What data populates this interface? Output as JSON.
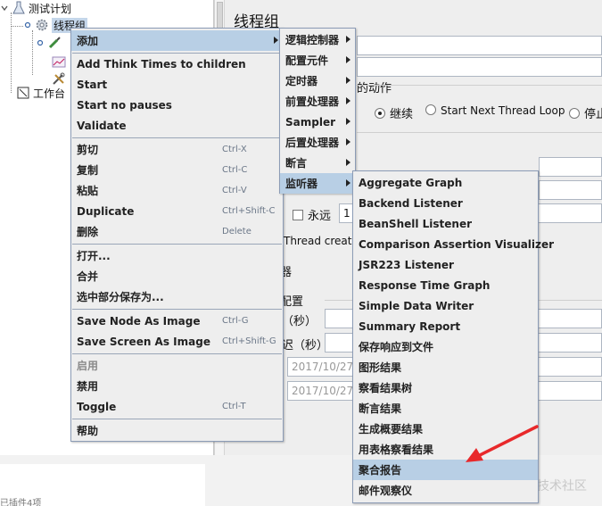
{
  "tree": {
    "test_plan": "测试计划",
    "thread_group": "线程组",
    "workbench": "工作台"
  },
  "panel": {
    "title": "线程组",
    "action_label": "的动作",
    "opt_continue": "继续",
    "opt_next_loop": "Start Next Thread Loop",
    "opt_stop": "停止",
    "forever_label": "永远",
    "loop_value": "1",
    "thread_creation": "Thread creat",
    "scheduler_fragment": "器",
    "config_fragment": "配置",
    "duration_fragment": "（秒）",
    "delay_fragment": "迟（秒）",
    "start_time": "2017/10/27",
    "end_time": "2017/10/27"
  },
  "bottom": {
    "status_text": "已插件4项",
    "watermark": "@稀土掘金技术社区"
  },
  "context_menu": {
    "items": [
      {
        "label": "添加",
        "submenu": true,
        "highlight": true
      },
      {
        "label": "Add Think Times to children"
      },
      {
        "label": "Start"
      },
      {
        "label": "Start no pauses"
      },
      {
        "label": "Validate"
      },
      {
        "label": "剪切",
        "shortcut": "Ctrl-X"
      },
      {
        "label": "复制",
        "shortcut": "Ctrl-C"
      },
      {
        "label": "粘贴",
        "shortcut": "Ctrl-V"
      },
      {
        "label": "Duplicate",
        "shortcut": "Ctrl+Shift-C"
      },
      {
        "label": "删除",
        "shortcut": "Delete"
      },
      {
        "label": "打开..."
      },
      {
        "label": "合并"
      },
      {
        "label": "选中部分保存为..."
      },
      {
        "label": "Save Node As Image",
        "shortcut": "Ctrl-G"
      },
      {
        "label": "Save Screen As Image",
        "shortcut": "Ctrl+Shift-G"
      },
      {
        "label": "启用",
        "disabled": true
      },
      {
        "label": "禁用"
      },
      {
        "label": "Toggle",
        "shortcut": "Ctrl-T"
      },
      {
        "label": "帮助"
      }
    ]
  },
  "add_submenu": {
    "items": [
      {
        "label": "逻辑控制器"
      },
      {
        "label": "配置元件"
      },
      {
        "label": "定时器"
      },
      {
        "label": "前置处理器"
      },
      {
        "label": "Sampler"
      },
      {
        "label": "后置处理器"
      },
      {
        "label": "断言"
      },
      {
        "label": "监听器",
        "highlight": true
      }
    ]
  },
  "listener_submenu": {
    "items": [
      {
        "label": "Aggregate Graph"
      },
      {
        "label": "Backend Listener"
      },
      {
        "label": "BeanShell Listener"
      },
      {
        "label": "Comparison Assertion Visualizer"
      },
      {
        "label": "JSR223 Listener"
      },
      {
        "label": "Response Time Graph"
      },
      {
        "label": "Simple Data Writer"
      },
      {
        "label": "Summary Report"
      },
      {
        "label": "保存响应到文件"
      },
      {
        "label": "图形结果"
      },
      {
        "label": "察看结果树"
      },
      {
        "label": "断言结果"
      },
      {
        "label": "生成概要结果"
      },
      {
        "label": "用表格察看结果"
      },
      {
        "label": "聚合报告",
        "highlight": true
      },
      {
        "label": "邮件观察仪"
      }
    ]
  },
  "colors": {
    "menu_bg": "#eeeeee",
    "highlight": "#b8cfe5",
    "menu_border": "#8c9cb6",
    "annotation_arrow": "#e8292b"
  }
}
